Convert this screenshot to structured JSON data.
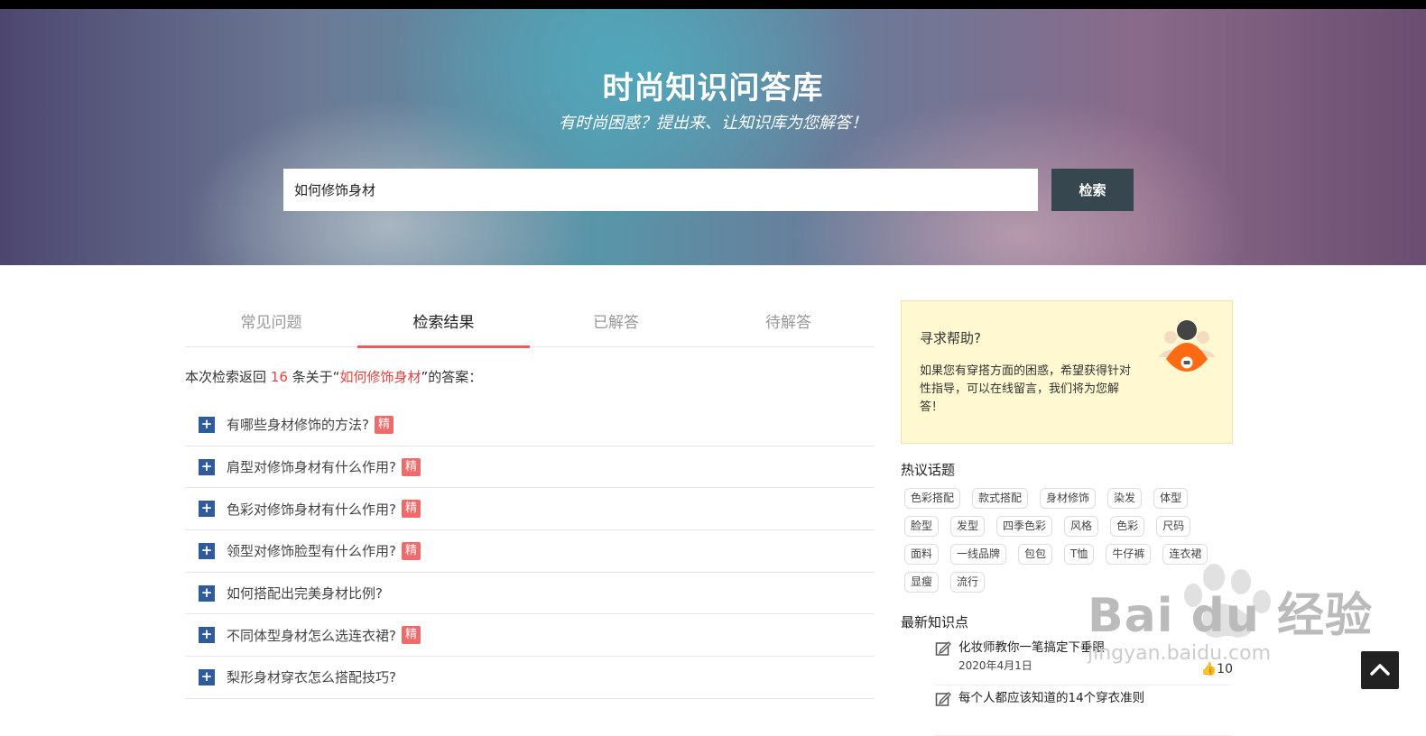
{
  "hero": {
    "title": "时尚知识问答库",
    "subtitle": "有时尚困惑？提出来、让知识库为您解答！"
  },
  "search": {
    "value": "如何修饰身材",
    "button_label": "检索"
  },
  "tabs": [
    "常见问题",
    "检索结果",
    "已解答",
    "待解答"
  ],
  "active_tab": "检索结果",
  "summary": {
    "prefix": "本次检索返回",
    "count": "16",
    "middle": "条关于“",
    "keyword": "如何修饰身材",
    "suffix": "”的答案："
  },
  "questions": [
    {
      "text": "有哪些身材修饰的方法?",
      "badge": "精"
    },
    {
      "text": "肩型对修饰身材有什么作用?",
      "badge": "精"
    },
    {
      "text": "色彩对修饰身材有什么作用?",
      "badge": "精"
    },
    {
      "text": "领型对修饰脸型有什么作用?",
      "badge": "精"
    },
    {
      "text": "如何搭配出完美身材比例?",
      "badge": ""
    },
    {
      "text": "不同体型身材怎么选连衣裙?",
      "badge": "精"
    },
    {
      "text": "梨形身材穿衣怎么搭配技巧?",
      "badge": ""
    }
  ],
  "help": {
    "title": "寻求帮助?",
    "text": "如果您有穿搭方面的困惑，希望获得针对性指导，可以在线留言，我们将为您解答！"
  },
  "hot_topics": {
    "title": "热议话题",
    "tags": [
      "色彩搭配",
      "款式搭配",
      "身材修饰",
      "染发",
      "体型",
      "脸型",
      "发型",
      "四季色彩",
      "风格",
      "色彩",
      "尺码",
      "面料",
      "一线品牌",
      "包包",
      "T恤",
      "牛仔裤",
      "连衣裙",
      "显瘦",
      "流行"
    ]
  },
  "latest": {
    "title": "最新知识点",
    "items": [
      {
        "title": "化妆师教你一笔搞定下垂眼",
        "date": "2020年4月1日",
        "likes": "10"
      },
      {
        "title": "每个人都应该知道的14个穿衣准则",
        "date": "",
        "likes": ""
      }
    ]
  },
  "watermark": {
    "text": "Bai du 经验",
    "sub": "jingyan.baidu.com"
  },
  "colors": {
    "accent": "#ef5b5b",
    "button": "#37474f",
    "plus": "#2f5b9a",
    "help_bg": "#fff8d1"
  }
}
